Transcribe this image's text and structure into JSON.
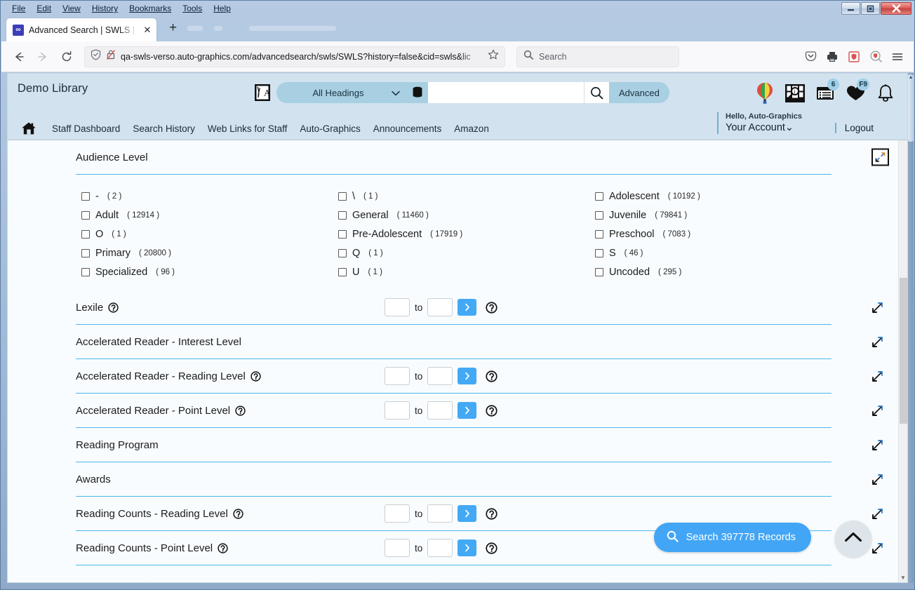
{
  "browser": {
    "menus": [
      "File",
      "Edit",
      "View",
      "History",
      "Bookmarks",
      "Tools",
      "Help"
    ],
    "tab_title": "Advanced Search | SWLS | SWLS",
    "url": "qa-swls-verso.auto-graphics.com/advancedsearch/swls/SWLS?history=false&cid=swls&lic",
    "search_placeholder": "Search",
    "window_controls": [
      "minimize",
      "maximize",
      "close"
    ]
  },
  "app": {
    "library_name": "Demo Library",
    "search": {
      "scope_label": "All Headings",
      "query_value": "",
      "advanced_label": "Advanced"
    },
    "account": {
      "greeting": "Hello, Auto-Graphics",
      "account_label": "Your Account",
      "logout_label": "Logout"
    },
    "header_badges": {
      "list_count": "6",
      "favorites_count": "F9"
    },
    "nav_links": [
      "Staff Dashboard",
      "Search History",
      "Web Links for Staff",
      "Auto-Graphics",
      "Announcements",
      "Amazon"
    ]
  },
  "form": {
    "audience": {
      "title": "Audience Level",
      "options": [
        {
          "label": "-",
          "count": "( 2 )"
        },
        {
          "label": "\\",
          "count": "( 1 )"
        },
        {
          "label": "Adolescent",
          "count": "( 10192 )"
        },
        {
          "label": "Adult",
          "count": "( 12914 )"
        },
        {
          "label": "General",
          "count": "( 11460 )"
        },
        {
          "label": "Juvenile",
          "count": "( 79841 )"
        },
        {
          "label": "O",
          "count": "( 1 )"
        },
        {
          "label": "Pre-Adolescent",
          "count": "( 17919 )"
        },
        {
          "label": "Preschool",
          "count": "( 7083 )"
        },
        {
          "label": "Primary",
          "count": "( 20800 )"
        },
        {
          "label": "Q",
          "count": "( 1 )"
        },
        {
          "label": "S",
          "count": "( 46 )"
        },
        {
          "label": "Specialized",
          "count": "( 96 )"
        },
        {
          "label": "U",
          "count": "( 1 )"
        },
        {
          "label": "Uncoded",
          "count": "( 295 )"
        }
      ]
    },
    "to_label": "to",
    "sections": [
      {
        "title": "Lexile",
        "help": true,
        "range": true,
        "from": "",
        "to": ""
      },
      {
        "title": "Accelerated Reader - Interest Level",
        "help": false,
        "range": false,
        "from": "",
        "to": ""
      },
      {
        "title": "Accelerated Reader - Reading Level",
        "help": true,
        "range": true,
        "from": "",
        "to": ""
      },
      {
        "title": "Accelerated Reader - Point Level",
        "help": true,
        "range": true,
        "from": "",
        "to": ""
      },
      {
        "title": "Reading Program",
        "help": false,
        "range": false,
        "from": "",
        "to": ""
      },
      {
        "title": "Awards",
        "help": false,
        "range": false,
        "from": "",
        "to": ""
      },
      {
        "title": "Reading Counts - Reading Level",
        "help": true,
        "range": true,
        "from": "",
        "to": ""
      },
      {
        "title": "Reading Counts - Point Level",
        "help": true,
        "range": true,
        "from": "",
        "to": ""
      }
    ]
  },
  "actions": {
    "search_records_label": "Search 397778 Records",
    "scroll_top_label": "Back to top"
  },
  "colors": {
    "accent_blue": "#42a5f5",
    "header_blue": "#d2e2ee",
    "rule_blue": "#4db8ea",
    "pill_blue": "#a8cfe2",
    "page_bg": "#f8fcfe"
  }
}
